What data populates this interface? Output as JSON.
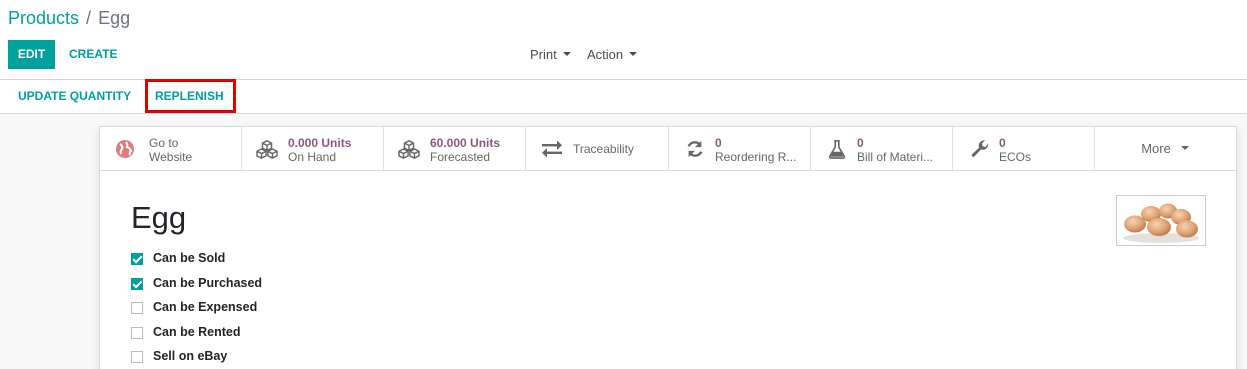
{
  "breadcrumb": {
    "parent": "Products",
    "separator": "/",
    "current": "Egg"
  },
  "toolbar": {
    "edit_label": "EDIT",
    "create_label": "CREATE",
    "print_label": "Print",
    "action_label": "Action"
  },
  "statusbar": {
    "update_quantity_label": "UPDATE QUANTITY",
    "replenish_label": "REPLENISH"
  },
  "smart_buttons": {
    "website": {
      "line1": "Go to",
      "line2": "Website",
      "icon": "globe-icon"
    },
    "on_hand": {
      "value": "0.000 Units",
      "label": "On Hand",
      "icon": "cubes-icon"
    },
    "forecasted": {
      "value": "60.000 Units",
      "label": "Forecasted",
      "icon": "cubes-icon"
    },
    "traceability": {
      "label": "Traceability",
      "icon": "arrows-exchange-icon"
    },
    "reordering": {
      "value": "0",
      "label": "Reordering R...",
      "icon": "refresh-icon"
    },
    "bom": {
      "value": "0",
      "label": "Bill of Materi...",
      "icon": "flask-icon"
    },
    "ecos": {
      "value": "0",
      "label": "ECOs",
      "icon": "wrench-icon"
    },
    "more_label": "More"
  },
  "product": {
    "name": "Egg",
    "options": [
      {
        "label": "Can be Sold",
        "checked": true
      },
      {
        "label": "Can be Purchased",
        "checked": true
      },
      {
        "label": "Can be Expensed",
        "checked": false
      },
      {
        "label": "Can be Rented",
        "checked": false
      },
      {
        "label": "Sell on eBay",
        "checked": false
      }
    ],
    "image": "eggs-image"
  },
  "colors": {
    "primary": "#00A09D",
    "smart_value": "#875A7B",
    "highlight_box": "#e00000"
  }
}
